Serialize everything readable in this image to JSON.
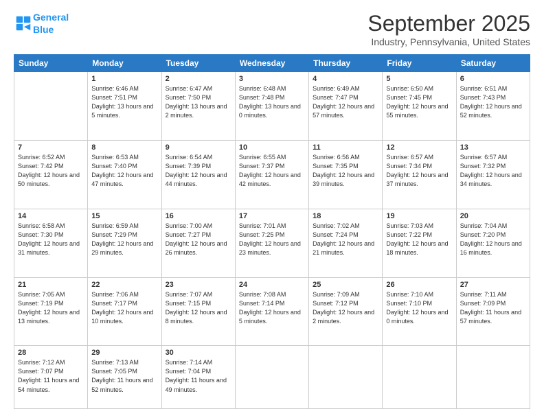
{
  "header": {
    "logo_line1": "General",
    "logo_line2": "Blue",
    "month": "September 2025",
    "location": "Industry, Pennsylvania, United States"
  },
  "weekdays": [
    "Sunday",
    "Monday",
    "Tuesday",
    "Wednesday",
    "Thursday",
    "Friday",
    "Saturday"
  ],
  "weeks": [
    [
      {
        "day": "",
        "sunrise": "",
        "sunset": "",
        "daylight": ""
      },
      {
        "day": "1",
        "sunrise": "Sunrise: 6:46 AM",
        "sunset": "Sunset: 7:51 PM",
        "daylight": "Daylight: 13 hours and 5 minutes."
      },
      {
        "day": "2",
        "sunrise": "Sunrise: 6:47 AM",
        "sunset": "Sunset: 7:50 PM",
        "daylight": "Daylight: 13 hours and 2 minutes."
      },
      {
        "day": "3",
        "sunrise": "Sunrise: 6:48 AM",
        "sunset": "Sunset: 7:48 PM",
        "daylight": "Daylight: 13 hours and 0 minutes."
      },
      {
        "day": "4",
        "sunrise": "Sunrise: 6:49 AM",
        "sunset": "Sunset: 7:47 PM",
        "daylight": "Daylight: 12 hours and 57 minutes."
      },
      {
        "day": "5",
        "sunrise": "Sunrise: 6:50 AM",
        "sunset": "Sunset: 7:45 PM",
        "daylight": "Daylight: 12 hours and 55 minutes."
      },
      {
        "day": "6",
        "sunrise": "Sunrise: 6:51 AM",
        "sunset": "Sunset: 7:43 PM",
        "daylight": "Daylight: 12 hours and 52 minutes."
      }
    ],
    [
      {
        "day": "7",
        "sunrise": "Sunrise: 6:52 AM",
        "sunset": "Sunset: 7:42 PM",
        "daylight": "Daylight: 12 hours and 50 minutes."
      },
      {
        "day": "8",
        "sunrise": "Sunrise: 6:53 AM",
        "sunset": "Sunset: 7:40 PM",
        "daylight": "Daylight: 12 hours and 47 minutes."
      },
      {
        "day": "9",
        "sunrise": "Sunrise: 6:54 AM",
        "sunset": "Sunset: 7:39 PM",
        "daylight": "Daylight: 12 hours and 44 minutes."
      },
      {
        "day": "10",
        "sunrise": "Sunrise: 6:55 AM",
        "sunset": "Sunset: 7:37 PM",
        "daylight": "Daylight: 12 hours and 42 minutes."
      },
      {
        "day": "11",
        "sunrise": "Sunrise: 6:56 AM",
        "sunset": "Sunset: 7:35 PM",
        "daylight": "Daylight: 12 hours and 39 minutes."
      },
      {
        "day": "12",
        "sunrise": "Sunrise: 6:57 AM",
        "sunset": "Sunset: 7:34 PM",
        "daylight": "Daylight: 12 hours and 37 minutes."
      },
      {
        "day": "13",
        "sunrise": "Sunrise: 6:57 AM",
        "sunset": "Sunset: 7:32 PM",
        "daylight": "Daylight: 12 hours and 34 minutes."
      }
    ],
    [
      {
        "day": "14",
        "sunrise": "Sunrise: 6:58 AM",
        "sunset": "Sunset: 7:30 PM",
        "daylight": "Daylight: 12 hours and 31 minutes."
      },
      {
        "day": "15",
        "sunrise": "Sunrise: 6:59 AM",
        "sunset": "Sunset: 7:29 PM",
        "daylight": "Daylight: 12 hours and 29 minutes."
      },
      {
        "day": "16",
        "sunrise": "Sunrise: 7:00 AM",
        "sunset": "Sunset: 7:27 PM",
        "daylight": "Daylight: 12 hours and 26 minutes."
      },
      {
        "day": "17",
        "sunrise": "Sunrise: 7:01 AM",
        "sunset": "Sunset: 7:25 PM",
        "daylight": "Daylight: 12 hours and 23 minutes."
      },
      {
        "day": "18",
        "sunrise": "Sunrise: 7:02 AM",
        "sunset": "Sunset: 7:24 PM",
        "daylight": "Daylight: 12 hours and 21 minutes."
      },
      {
        "day": "19",
        "sunrise": "Sunrise: 7:03 AM",
        "sunset": "Sunset: 7:22 PM",
        "daylight": "Daylight: 12 hours and 18 minutes."
      },
      {
        "day": "20",
        "sunrise": "Sunrise: 7:04 AM",
        "sunset": "Sunset: 7:20 PM",
        "daylight": "Daylight: 12 hours and 16 minutes."
      }
    ],
    [
      {
        "day": "21",
        "sunrise": "Sunrise: 7:05 AM",
        "sunset": "Sunset: 7:19 PM",
        "daylight": "Daylight: 12 hours and 13 minutes."
      },
      {
        "day": "22",
        "sunrise": "Sunrise: 7:06 AM",
        "sunset": "Sunset: 7:17 PM",
        "daylight": "Daylight: 12 hours and 10 minutes."
      },
      {
        "day": "23",
        "sunrise": "Sunrise: 7:07 AM",
        "sunset": "Sunset: 7:15 PM",
        "daylight": "Daylight: 12 hours and 8 minutes."
      },
      {
        "day": "24",
        "sunrise": "Sunrise: 7:08 AM",
        "sunset": "Sunset: 7:14 PM",
        "daylight": "Daylight: 12 hours and 5 minutes."
      },
      {
        "day": "25",
        "sunrise": "Sunrise: 7:09 AM",
        "sunset": "Sunset: 7:12 PM",
        "daylight": "Daylight: 12 hours and 2 minutes."
      },
      {
        "day": "26",
        "sunrise": "Sunrise: 7:10 AM",
        "sunset": "Sunset: 7:10 PM",
        "daylight": "Daylight: 12 hours and 0 minutes."
      },
      {
        "day": "27",
        "sunrise": "Sunrise: 7:11 AM",
        "sunset": "Sunset: 7:09 PM",
        "daylight": "Daylight: 11 hours and 57 minutes."
      }
    ],
    [
      {
        "day": "28",
        "sunrise": "Sunrise: 7:12 AM",
        "sunset": "Sunset: 7:07 PM",
        "daylight": "Daylight: 11 hours and 54 minutes."
      },
      {
        "day": "29",
        "sunrise": "Sunrise: 7:13 AM",
        "sunset": "Sunset: 7:05 PM",
        "daylight": "Daylight: 11 hours and 52 minutes."
      },
      {
        "day": "30",
        "sunrise": "Sunrise: 7:14 AM",
        "sunset": "Sunset: 7:04 PM",
        "daylight": "Daylight: 11 hours and 49 minutes."
      },
      {
        "day": "",
        "sunrise": "",
        "sunset": "",
        "daylight": ""
      },
      {
        "day": "",
        "sunrise": "",
        "sunset": "",
        "daylight": ""
      },
      {
        "day": "",
        "sunrise": "",
        "sunset": "",
        "daylight": ""
      },
      {
        "day": "",
        "sunrise": "",
        "sunset": "",
        "daylight": ""
      }
    ]
  ]
}
